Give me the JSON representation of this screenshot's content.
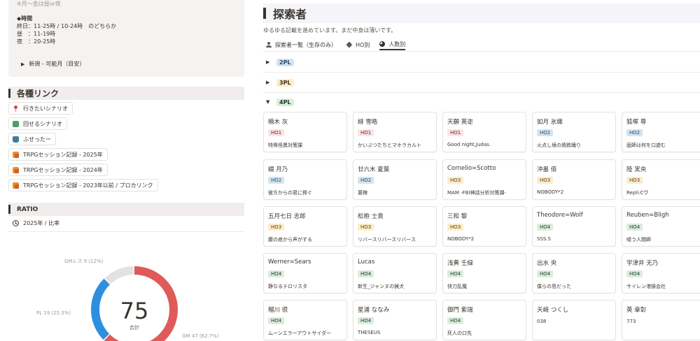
{
  "callout": {
    "note": "※月〜金は昼or夜",
    "time_heading": "◆時間",
    "rows": [
      "終日：11-25時 / 10-24時　のどちらか",
      "昼　：11-19時",
      "夜　：20-25時"
    ],
    "toggle_label": "新規 - 可能月（目安）"
  },
  "links_section": {
    "title": "各種リンク",
    "links": [
      {
        "label": "行きたいシナリオ",
        "icon": "pin-icon"
      },
      {
        "label": "回せるシナリオ",
        "icon": "book-icon"
      },
      {
        "label": "ふせったー",
        "icon": "bag-icon"
      },
      {
        "label": "TRPGセッション記録 - 2025年",
        "icon": "folder-icon"
      },
      {
        "label": "TRPGセッション記録 - 2024年",
        "icon": "folder-icon"
      },
      {
        "label": "TRPGセッション記録 - 2023年以前 / プロカリンク",
        "icon": "folder-icon"
      }
    ]
  },
  "ratio_section": {
    "title": "RATIO",
    "subtitle": "2025年 / 比率"
  },
  "chart_data": {
    "type": "pie",
    "total": 75,
    "total_label": "合計",
    "slices": [
      {
        "label": "GM",
        "value": 47,
        "percent": "62.7%",
        "color": "#e05a5a"
      },
      {
        "label": "PL",
        "value": 19,
        "percent": "25.3%",
        "color": "#2f8fdf"
      },
      {
        "label": "GMレス",
        "value": 9,
        "percent": "12%",
        "color": "#e2e2e0"
      }
    ],
    "slice_labels": [
      "GM  47 (62.7%)",
      "PL  19 (25.3%)",
      "GMレス  9 (12%)"
    ]
  },
  "page": {
    "title": "探索者",
    "description": "ゆるゆる記載を進めています。まだ中身は薄いです。",
    "tabs": [
      {
        "label": "探索者一覧（生存のみ）",
        "icon": "person-icon"
      },
      {
        "label": "HO別",
        "icon": "tag-icon"
      },
      {
        "label": "人数別",
        "icon": "pie-icon"
      }
    ],
    "groups": [
      {
        "label": "2PL",
        "collapsed": true
      },
      {
        "label": "3PL",
        "collapsed": true
      },
      {
        "label": "4PL",
        "collapsed": false
      }
    ]
  },
  "cards": [
    {
      "name": "楠木 灰",
      "ho": "HO1",
      "scenario": "特殊怪異対策課"
    },
    {
      "name": "緋 雪晧",
      "ho": "HO1",
      "scenario": "かいぶつたちとマホラカルト"
    },
    {
      "name": "天願 英迩",
      "ho": "HO1",
      "scenario": "Good night,Judas."
    },
    {
      "name": "如月 氷織",
      "ho": "HO2",
      "scenario": "火点し境の焼鉄踊り"
    },
    {
      "name": "狐塚 尊",
      "ho": "HO2",
      "scenario": "庭師は何を口遊む"
    },
    {
      "name": "綴 月乃",
      "ho": "HO2",
      "scenario": "彼方からの君に捧ぐ"
    },
    {
      "name": "廿六木 夏葉",
      "ho": "HO2",
      "scenario": "悪辣"
    },
    {
      "name": "Cornelio=Scotto",
      "ho": "HO3",
      "scenario": "MAM -FBI神話分析対策課-"
    },
    {
      "name": "沖墨 佰",
      "ho": "HO3",
      "scenario": "NOBODY*2"
    },
    {
      "name": "陸 実央",
      "ho": "HO3",
      "scenario": "Repli:Cヴ"
    },
    {
      "name": "五月七日 志郎",
      "ho": "HO3",
      "scenario": "腹の底から声がする"
    },
    {
      "name": "松栫 士貴",
      "ho": "HO3",
      "scenario": "リバースリバースリバース"
    },
    {
      "name": "三和 黎",
      "ho": "HO3",
      "scenario": "NOBODY*2"
    },
    {
      "name": "Theodore=Wolf",
      "ho": "HO4",
      "scenario": "SSS.S"
    },
    {
      "name": "Reuben=Bligh",
      "ho": "HO4",
      "scenario": "嘘う人閲師"
    },
    {
      "name": "Werner=Sears",
      "ho": "HO4",
      "scenario": "静なるテロリスタ"
    },
    {
      "name": "Lucas",
      "ho": "HO4",
      "scenario": "新生_ジャンヌの猟犬"
    },
    {
      "name": "浅黄 壬緑",
      "ho": "HO4",
      "scenario": "快刀乱魔"
    },
    {
      "name": "出水 央",
      "ho": "HO4",
      "scenario": "僕らの島だった"
    },
    {
      "name": "宇津井 无乃",
      "ho": "HO4",
      "scenario": "サイレン港操会社"
    },
    {
      "name": "榴川 很",
      "ho": "HO4",
      "scenario": "ムーンエラーアウトサイダー"
    },
    {
      "name": "星浦 ななみ",
      "ho": "HO4",
      "scenario": "THESEUS"
    },
    {
      "name": "御門 紫瑞",
      "ho": "HO4",
      "scenario": "死人の口先"
    },
    {
      "name": "天崎 つくし",
      "ho": "",
      "scenario": "038"
    },
    {
      "name": "英 章彰",
      "ho": "",
      "scenario": "773"
    }
  ]
}
